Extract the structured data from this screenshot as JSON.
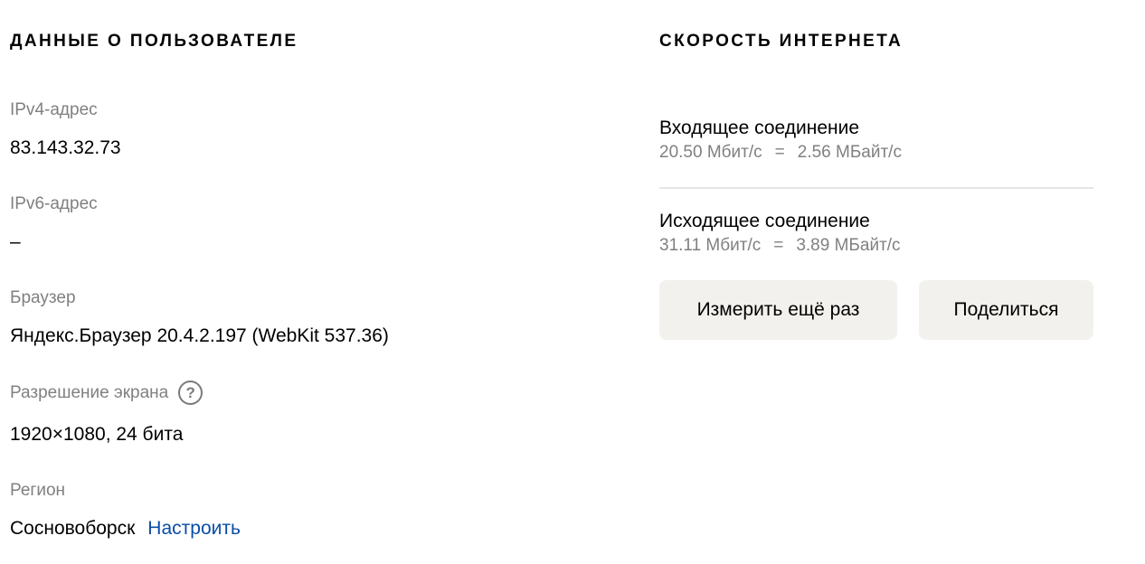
{
  "user": {
    "title": "ДАННЫЕ О ПОЛЬЗОВАТЕЛЕ",
    "ipv4": {
      "label": "IPv4-адрес",
      "value": "83.143.32.73"
    },
    "ipv6": {
      "label": "IPv6-адрес",
      "value": "–"
    },
    "browser": {
      "label": "Браузер",
      "value": "Яндекс.Браузер 20.4.2.197 (WebKit 537.36)"
    },
    "screen": {
      "label": "Разрешение экрана",
      "help_icon": "?",
      "value": "1920×1080, 24 бита"
    },
    "region": {
      "label": "Регион",
      "value": "Сосновоборск",
      "link": "Настроить"
    }
  },
  "speed": {
    "title": "СКОРОСТЬ ИНТЕРНЕТА",
    "incoming": {
      "label": "Входящее соединение",
      "mbit": "20.50 Мбит/с",
      "eq": "=",
      "mbyte": "2.56 МБайт/с"
    },
    "outgoing": {
      "label": "Исходящее соединение",
      "mbit": "31.11 Мбит/с",
      "eq": "=",
      "mbyte": "3.89 МБайт/с"
    },
    "measure_button": "Измерить ещё раз",
    "share_button": "Поделиться"
  },
  "colors": {
    "link": "#0a4da8",
    "label_gray": "#808080",
    "button_bg": "#f2f1ed"
  }
}
